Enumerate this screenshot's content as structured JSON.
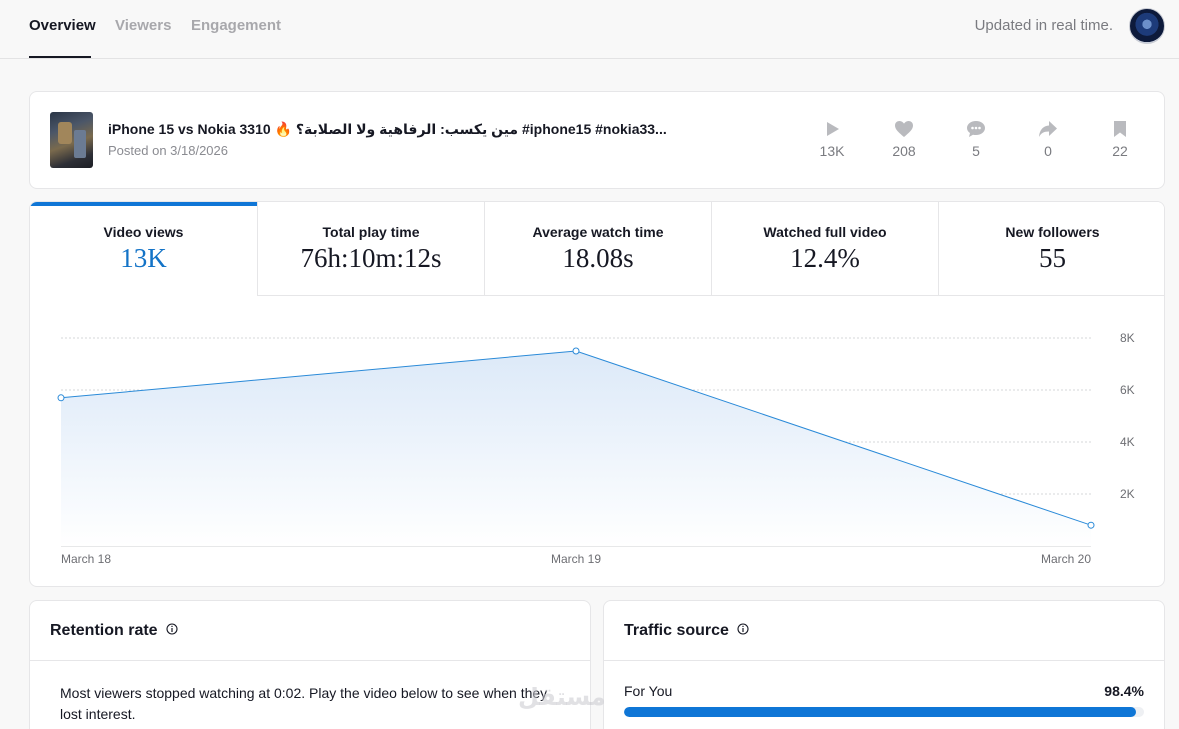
{
  "nav": {
    "tabs": [
      {
        "label": "Overview",
        "active": true
      },
      {
        "label": "Viewers",
        "active": false
      },
      {
        "label": "Engagement",
        "active": false
      }
    ],
    "updated_text": "Updated in real time."
  },
  "video": {
    "title": "iPhone 15 vs Nokia 3310 🔥 مين يكسب: الرفاهية ولا الصلابة؟ #iphone15 #nokia33...",
    "posted": "Posted on 3/18/2026",
    "stats": [
      {
        "icon": "play-icon",
        "value": "13K"
      },
      {
        "icon": "heart-icon",
        "value": "208"
      },
      {
        "icon": "comment-icon",
        "value": "5"
      },
      {
        "icon": "share-icon",
        "value": "0"
      },
      {
        "icon": "bookmark-icon",
        "value": "22"
      }
    ]
  },
  "metrics": [
    {
      "label": "Video views",
      "value": "13K",
      "active": true
    },
    {
      "label": "Total play time",
      "value": "76h:10m:12s",
      "active": false
    },
    {
      "label": "Average watch time",
      "value": "18.08s",
      "active": false
    },
    {
      "label": "Watched full video",
      "value": "12.4%",
      "active": false
    },
    {
      "label": "New followers",
      "value": "55",
      "active": false
    }
  ],
  "chart_data": {
    "type": "area",
    "x": [
      "March 18",
      "March 19",
      "March 20"
    ],
    "values": [
      5700,
      7500,
      800
    ],
    "yticks": [
      "2K",
      "4K",
      "6K",
      "8K"
    ],
    "ylim": [
      0,
      8000
    ],
    "grid": true,
    "colors": {
      "line": "#2a8ad8",
      "fill": "#e3eefa"
    }
  },
  "retention": {
    "title": "Retention rate",
    "text": "Most viewers stopped watching at 0:02. Play the video below to see when they lost interest."
  },
  "traffic": {
    "title": "Traffic source",
    "sources": [
      {
        "label": "For You",
        "percent_text": "98.4%",
        "percent": 98.4
      }
    ]
  },
  "watermark": "مستقل"
}
